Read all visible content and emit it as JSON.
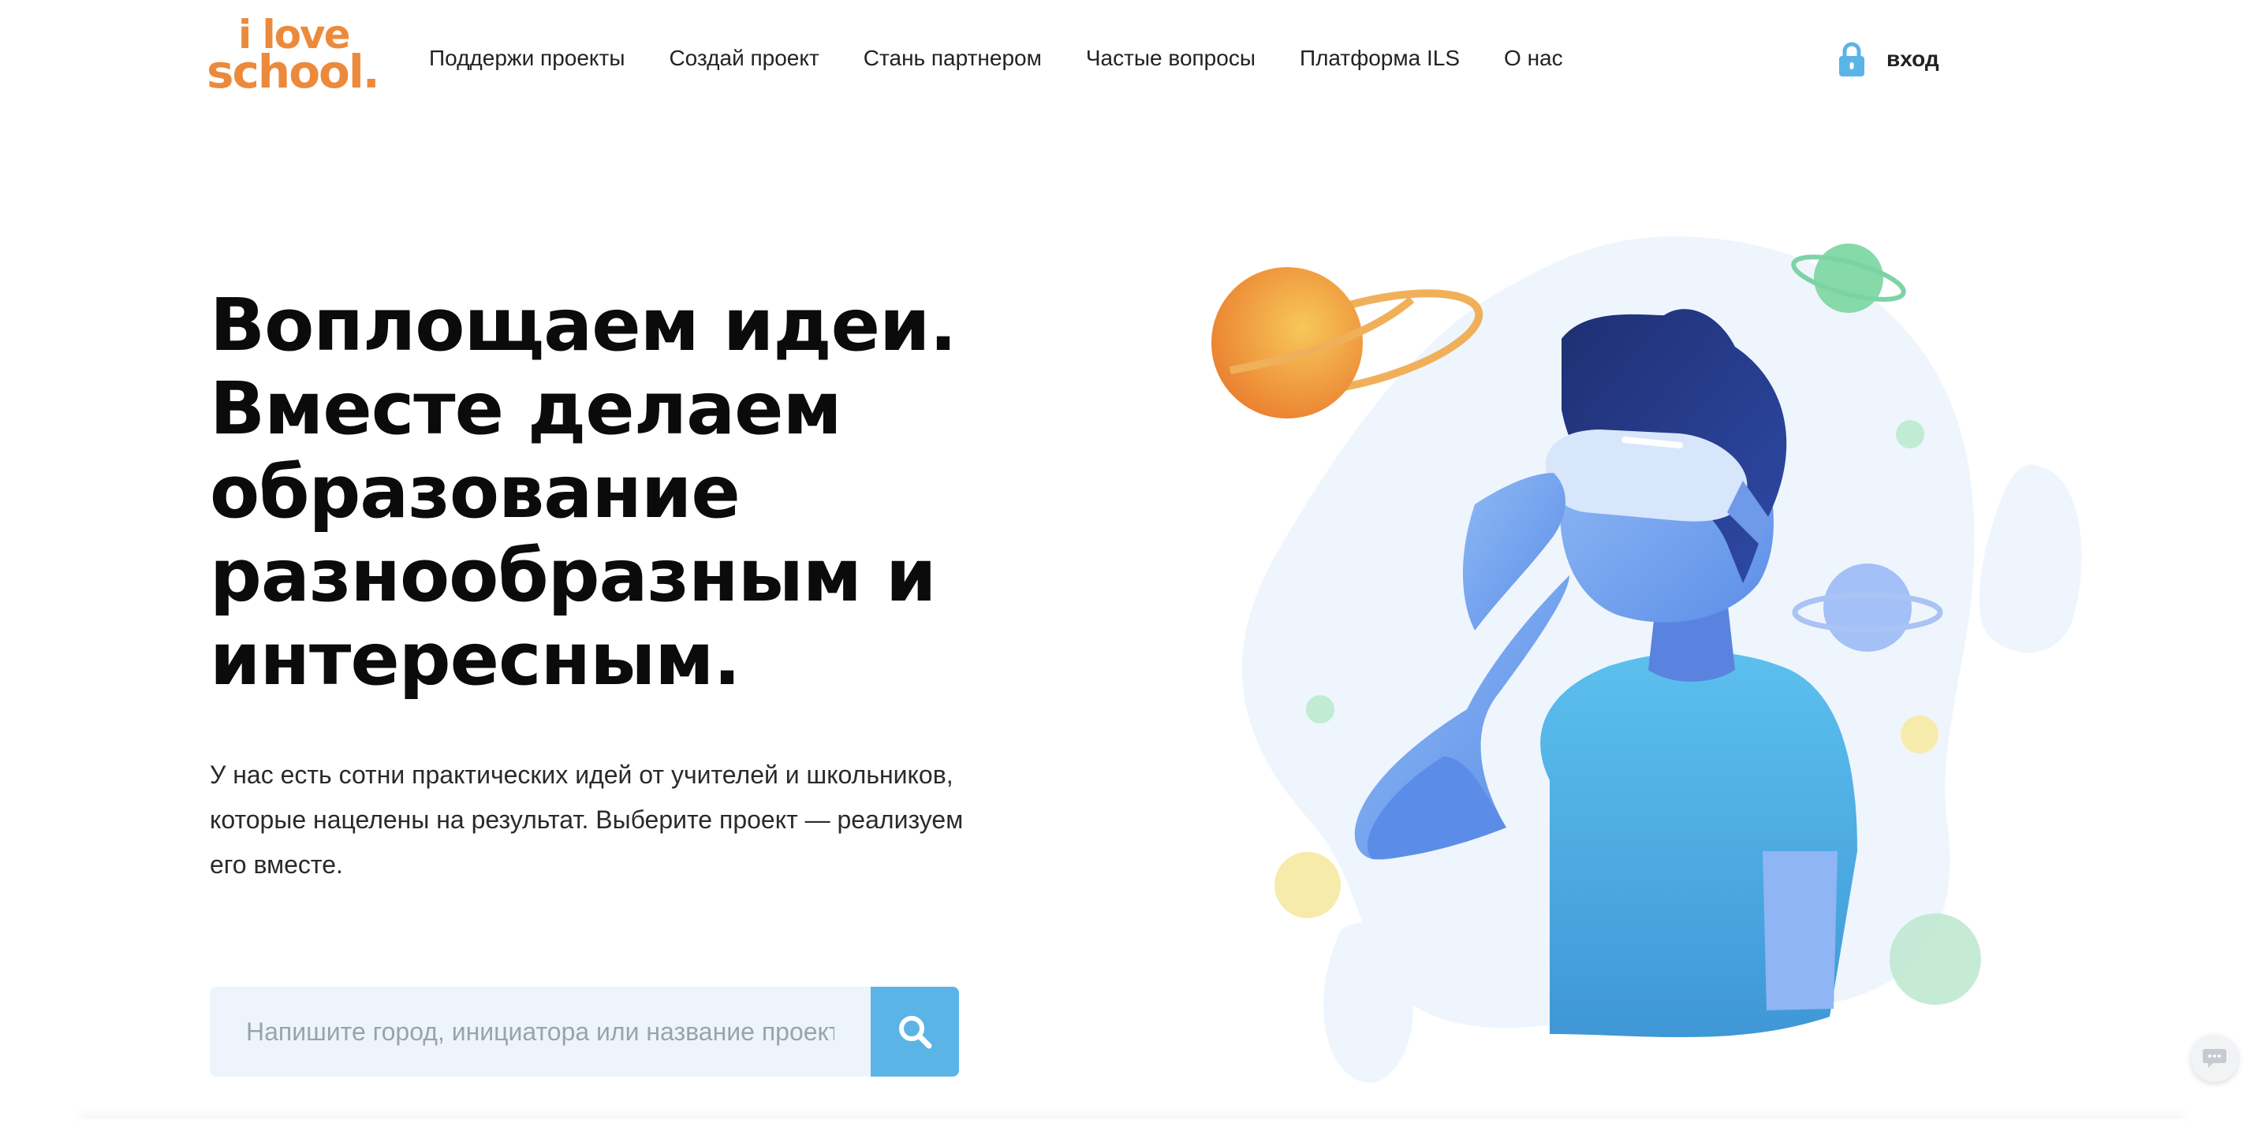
{
  "brand": {
    "logo_line1": "i love",
    "logo_line2": "school.",
    "accent": "#ec8a3c"
  },
  "nav": {
    "items": [
      {
        "label": "Поддержи проекты"
      },
      {
        "label": "Создай проект"
      },
      {
        "label": "Стань партнером"
      },
      {
        "label": "Частые вопросы"
      },
      {
        "label": "Платформа ILS"
      },
      {
        "label": "О нас"
      }
    ]
  },
  "login": {
    "label": "вход",
    "icon": "lock-icon",
    "icon_color": "#5ab5e6"
  },
  "hero": {
    "headline": "Воплощаем идеи. Вместе делаем образование разнообразным и интересным.",
    "subtext": "У нас есть сотни практических идей от учителей и школьников, которые нацелены на результат. Выберите проект — реализуем его вместе."
  },
  "search": {
    "placeholder": "Напишите город, инициатора или название проекта",
    "value": "",
    "button_icon": "search-icon",
    "button_color": "#5ab5e6"
  },
  "chat": {
    "icon": "chat-icon"
  }
}
